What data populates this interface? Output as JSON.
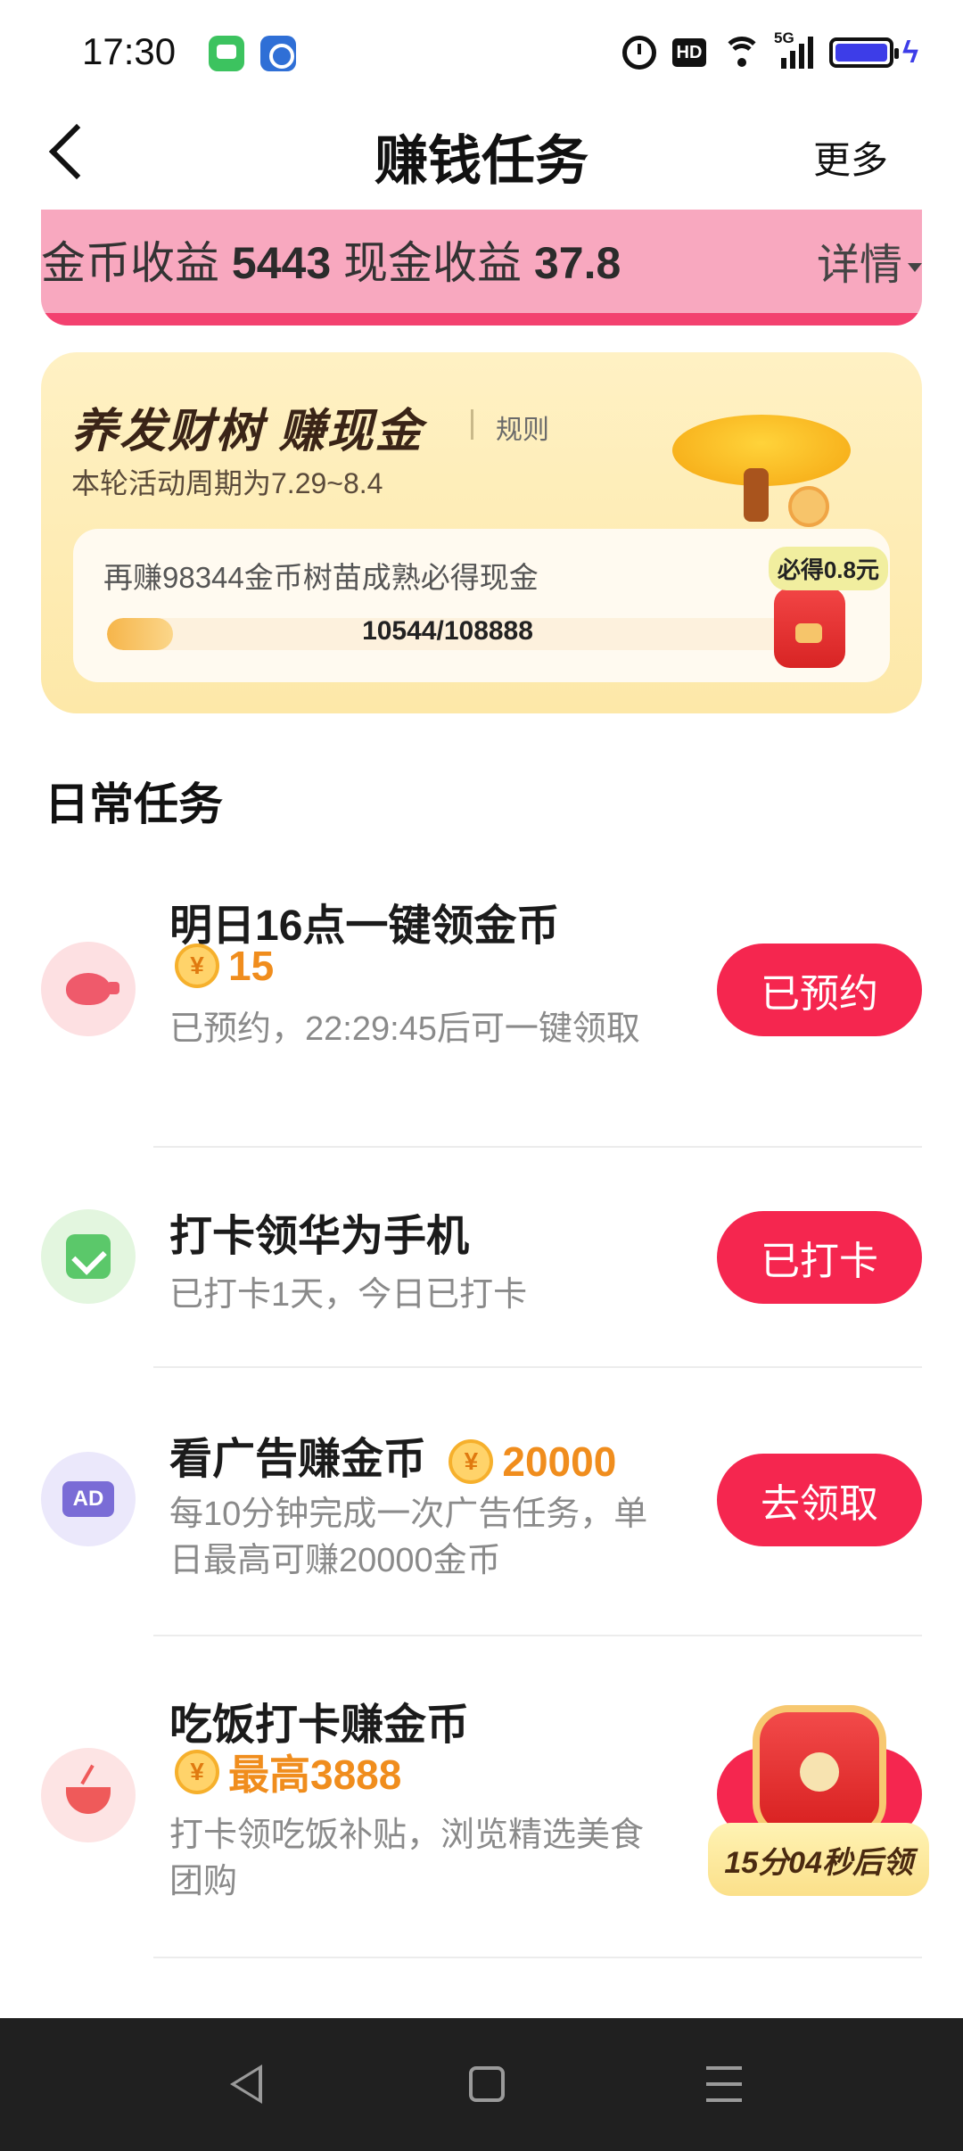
{
  "status_bar": {
    "time": "17:30",
    "hd_label": "HD",
    "network_label": "5G",
    "icons": [
      "messages-app-icon",
      "bank-app-icon",
      "alarm-icon",
      "hd-icon",
      "wifi-icon",
      "signal-icon",
      "battery-icon",
      "charging-icon"
    ]
  },
  "header": {
    "title": "赚钱任务",
    "more_label": "更多"
  },
  "earnings": {
    "coin_label": "金币收益",
    "coin_value": "5443",
    "cash_label": "现金收益",
    "cash_value": "37.8",
    "detail_label": "详情"
  },
  "tree_card": {
    "title": "养发财树 赚现金",
    "rules_label": "规则",
    "period": "本轮活动周期为7.29~8.4",
    "progress_label": "再赚98344金币树苗成熟必得现金",
    "progress_value_text": "10544/108888",
    "progress_fraction": 0.097,
    "reward_tag": "必得0.8元"
  },
  "daily_tasks": {
    "title": "日常任务",
    "items": [
      {
        "name": "明日16点一键领金币",
        "reward": "15",
        "description": "已预约，22:29:45后可一键领取",
        "button": "已预约",
        "icon": "piggy-bank-icon"
      },
      {
        "name": "打卡领华为手机",
        "description": "已打卡1天，今日已打卡",
        "button": "已打卡",
        "icon": "calendar-check-icon"
      },
      {
        "name": "看广告赚金币",
        "reward": "20000",
        "description": "每10分钟完成一次广告任务，单日最高可赚20000金币",
        "button": "去领取",
        "icon": "ad-icon"
      },
      {
        "name": "吃饭打卡赚金币",
        "reward": "最高3888",
        "description": "打卡领吃饭补贴，浏览精选美食团购",
        "timer": "15分04秒后领",
        "icon": "bowl-icon"
      }
    ]
  },
  "colors": {
    "accent_red": "#f5264f",
    "coin_orange": "#f08d1d",
    "banner_pink": "#f8a8bf",
    "tree_card_bg": "#fff1c4"
  }
}
